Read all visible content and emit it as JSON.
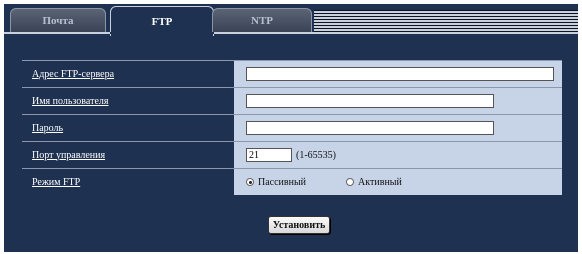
{
  "tabs": [
    {
      "label": "Почта",
      "active": false
    },
    {
      "label": "FTP",
      "active": true
    },
    {
      "label": "NTP",
      "active": false
    }
  ],
  "form": {
    "server_address": {
      "label": "Адрес FTP-сервера",
      "value": ""
    },
    "username": {
      "label": "Имя пользователя",
      "value": ""
    },
    "password": {
      "label": "Пароль",
      "value": ""
    },
    "control_port": {
      "label": "Порт управления",
      "value": "21",
      "range": "(1-65535)"
    },
    "ftp_mode": {
      "label": "Режим FTP",
      "options": [
        {
          "label": "Пассивный",
          "selected": true
        },
        {
          "label": "Активный",
          "selected": false
        }
      ]
    }
  },
  "apply_label": "Установить",
  "colors": {
    "panel": "#1f3150",
    "value_cell": "#c7d4e8"
  }
}
